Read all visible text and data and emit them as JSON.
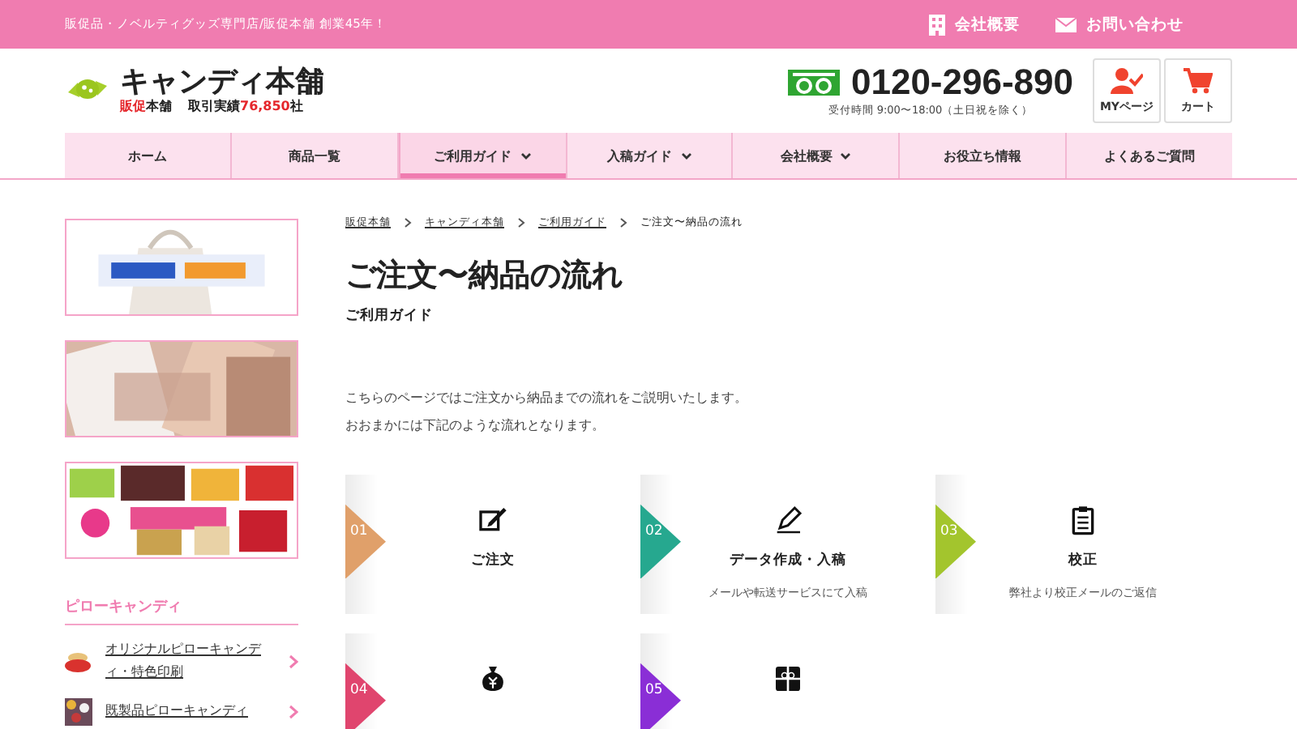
{
  "top_bar": {
    "tagline": "販促品・ノベルティグッズ専門店/販促本舗 創業45年！",
    "links": [
      {
        "label": "会社概要"
      },
      {
        "label": "お問い合わせ"
      }
    ]
  },
  "header": {
    "logo_title": "キャンディ本舗",
    "logo_sub_brand_mark": "販促",
    "logo_sub_brand": "本舗",
    "record_label": "取引実績",
    "record_count": "76,850",
    "record_unit": "社",
    "phone": "0120-296-890",
    "hours": "受付時間 9:00〜18:00（土日祝を除く）",
    "buttons": [
      {
        "label": "MYページ"
      },
      {
        "label": "カート"
      }
    ]
  },
  "nav": [
    {
      "label": "ホーム",
      "dropdown": false,
      "selected": false
    },
    {
      "label": "商品一覧",
      "dropdown": false,
      "selected": false
    },
    {
      "label": "ご利用ガイド",
      "dropdown": true,
      "selected": true
    },
    {
      "label": "入稿ガイド",
      "dropdown": true,
      "selected": false
    },
    {
      "label": "会社概要",
      "dropdown": true,
      "selected": false
    },
    {
      "label": "お役立ち情報",
      "dropdown": false,
      "selected": false
    },
    {
      "label": "よくあるご質問",
      "dropdown": false,
      "selected": false
    }
  ],
  "sidebar": {
    "section_title": "ピローキャンディ",
    "items": [
      {
        "label": "オリジナルピローキャンディ・特色印刷"
      },
      {
        "label": "既製品ピローキャンディ"
      }
    ]
  },
  "breadcrumb": [
    {
      "label": "販促本舗",
      "link": true
    },
    {
      "label": "キャンディ本舗",
      "link": true
    },
    {
      "label": "ご利用ガイド",
      "link": true
    },
    {
      "label": "ご注文〜納品の流れ",
      "link": false
    }
  ],
  "page": {
    "title": "ご注文〜納品の流れ",
    "subtitle": "ご利用ガイド",
    "intro": [
      "こちらのページではご注文から納品までの流れをご説明いたします。",
      "おおまかには下記のような流れとなります。"
    ]
  },
  "steps": [
    {
      "number": "01",
      "color": "#e0a06a",
      "title": "ご注文"
    },
    {
      "number": "02",
      "color": "#26a88f",
      "title": "データ作成・入稿",
      "description": "メールや転送サービスにて入稿"
    },
    {
      "number": "03",
      "color": "#a3c52d",
      "title": "校正",
      "description": "弊社より校正メールのご返信"
    },
    {
      "number": "04",
      "color": "#e0456e"
    },
    {
      "number": "05",
      "color": "#8a2ed6"
    }
  ]
}
